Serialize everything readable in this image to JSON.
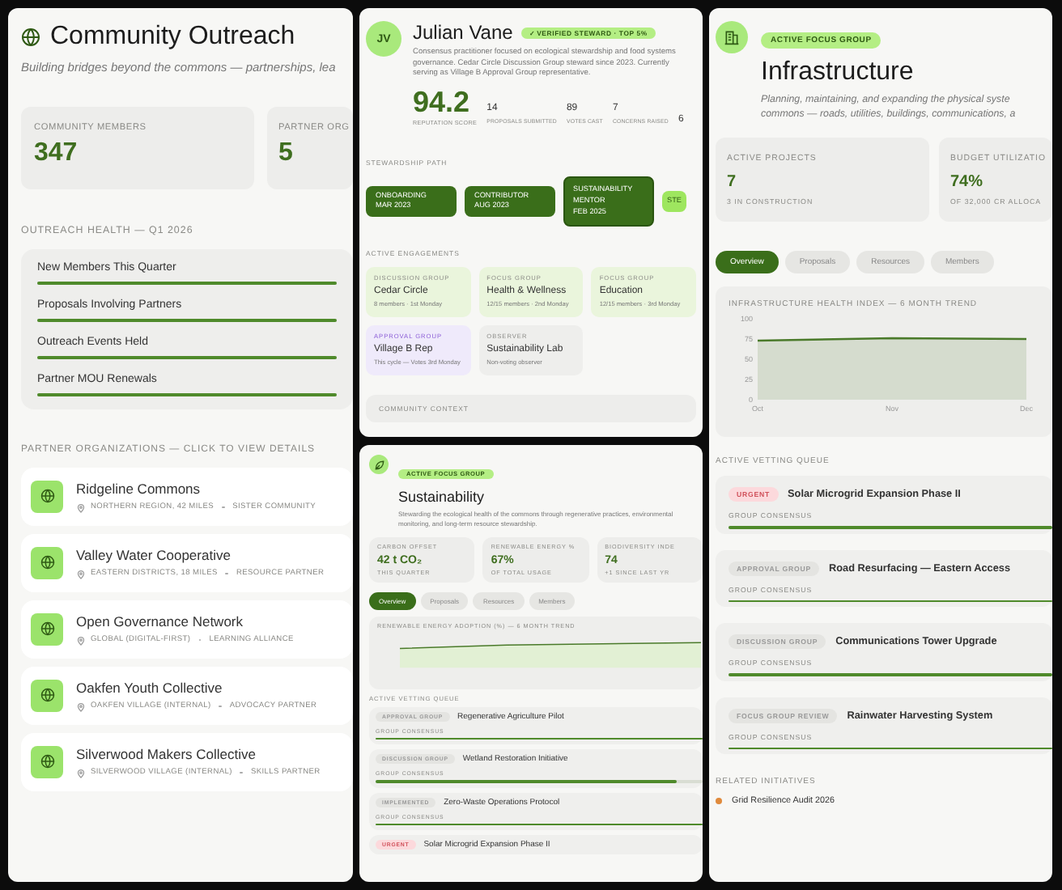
{
  "outreach": {
    "title": "Community Outreach",
    "subtitle": "Building bridges beyond the commons — partnerships, lea",
    "stats": [
      {
        "label": "COMMUNITY MEMBERS",
        "value": "347"
      },
      {
        "label": "PARTNER ORG",
        "value": "5"
      }
    ],
    "health_title": "OUTREACH HEALTH — Q1 2026",
    "health": [
      {
        "label": "New Members This Quarter",
        "level": 1
      },
      {
        "label": "Proposals Involving Partners",
        "level": 1
      },
      {
        "label": "Outreach Events Held",
        "level": 1
      },
      {
        "label": "Partner MOU Renewals",
        "level": 1
      }
    ],
    "partners_title": "PARTNER ORGANIZATIONS — CLICK TO VIEW DETAILS",
    "partners": [
      {
        "name": "Ridgeline Commons",
        "location": "NORTHERN REGION, 42 MILES",
        "type": "SISTER COMMUNITY"
      },
      {
        "name": "Valley Water Cooperative",
        "location": "EASTERN DISTRICTS, 18 MILES",
        "type": "RESOURCE PARTNER"
      },
      {
        "name": "Open Governance Network",
        "location": "GLOBAL (DIGITAL-FIRST)",
        "type": "LEARNING ALLIANCE"
      },
      {
        "name": "Oakfen Youth Collective",
        "location": "OAKFEN VILLAGE (INTERNAL)",
        "type": "ADVOCACY PARTNER"
      },
      {
        "name": "Silverwood Makers Collective",
        "location": "SILVERWOOD VILLAGE (INTERNAL)",
        "type": "SKILLS PARTNER"
      }
    ]
  },
  "profile": {
    "initials": "JV",
    "name": "Julian Vane",
    "badge": "✓ VERIFIED STEWARD · TOP 5%",
    "bio": "Consensus practitioner focused on ecological stewardship and food systems governance. Cedar Circle Discussion Group steward since 2023. Currently serving as Village B Approval Group representative.",
    "score": "94.2",
    "score_label": "REPUTATION SCORE",
    "stats": [
      {
        "value": "14",
        "label": "PROPOSALS SUBMITTED"
      },
      {
        "value": "89",
        "label": "VOTES CAST"
      },
      {
        "value": "7",
        "label": "CONCERNS RAISED"
      },
      {
        "value": "6"
      }
    ],
    "path_title": "STEWARDSHIP PATH",
    "path": [
      {
        "label": "ONBOARDING",
        "date": "MAR 2023",
        "kind": "done"
      },
      {
        "label": "CONTRIBUTOR",
        "date": "AUG 2023",
        "kind": "done"
      },
      {
        "label": "SUSTAINABILITY MENTOR",
        "date": "FEB 2025",
        "kind": "current"
      },
      {
        "label": "STE",
        "kind": "next"
      }
    ],
    "engagements_title": "ACTIVE ENGAGEMENTS",
    "engagements": [
      {
        "type": "DISCUSSION GROUP",
        "name": "Cedar Circle",
        "meta": "8 members · 1st Monday",
        "kind": "group"
      },
      {
        "type": "FOCUS GROUP",
        "name": "Health & Wellness",
        "meta": "12/15 members · 2nd Monday",
        "kind": "group"
      },
      {
        "type": "FOCUS GROUP",
        "name": "Education",
        "meta": "12/15 members · 3rd Monday",
        "kind": "group"
      },
      {
        "type": "APPROVAL GROUP",
        "name": "Village B Rep",
        "meta": "This cycle — Votes 3rd Monday",
        "kind": "approval"
      },
      {
        "type": "OBSERVER",
        "name": "Sustainability Lab",
        "meta": "Non-voting observer",
        "kind": "observer"
      }
    ],
    "context_title": "COMMUNITY CONTEXT"
  },
  "sustainability": {
    "badge": "ACTIVE FOCUS GROUP",
    "title": "Sustainability",
    "description": "Stewarding the ecological health of the commons through regenerative practices, environmental monitoring, and long-term resource stewardship.",
    "stats": [
      {
        "label": "CARBON OFFSET",
        "value": "42 t CO₂",
        "note": "THIS QUARTER"
      },
      {
        "label": "RENEWABLE ENERGY %",
        "value": "67%",
        "note": "OF TOTAL USAGE"
      },
      {
        "label": "BIODIVERSITY INDE",
        "value": "74",
        "note": "+1 SINCE LAST YR"
      }
    ],
    "tabs": [
      {
        "label": "Overview",
        "selected": true
      },
      {
        "label": "Proposals",
        "selected": false
      },
      {
        "label": "Resources",
        "selected": false
      },
      {
        "label": "Members",
        "selected": false
      }
    ],
    "chart_title": "RENEWABLE ENERGY ADOPTION (%) — 6 MONTH TREND",
    "queue_title": "ACTIVE VETTING QUEUE",
    "queue": [
      {
        "tag": "APPROVAL GROUP",
        "kind": "stage",
        "title": "Regenerative Agriculture Pilot",
        "consensus": "GROUP CONSENSUS",
        "level": 1
      },
      {
        "tag": "DISCUSSION GROUP",
        "kind": "stage",
        "title": "Wetland Restoration Initiative",
        "consensus": "GROUP CONSENSUS",
        "level": 0.92
      },
      {
        "tag": "IMPLEMENTED",
        "kind": "stage",
        "title": "Zero-Waste Operations Protocol",
        "consensus": "GROUP CONSENSUS",
        "level": 1
      },
      {
        "tag": "URGENT",
        "kind": "urgent",
        "title": "Solar Microgrid Expansion Phase II"
      }
    ]
  },
  "infrastructure": {
    "badge": "ACTIVE FOCUS GROUP",
    "title": "Infrastructure",
    "description_lines": [
      "Planning, maintaining, and expanding the physical syste",
      "commons — roads, utilities, buildings, communications, a"
    ],
    "stats": [
      {
        "label": "ACTIVE PROJECTS",
        "value": "7",
        "note": "3 IN CONSTRUCTION"
      },
      {
        "label": "BUDGET UTILIZATIO",
        "value": "74%",
        "note": "OF 32,000 CR ALLOCA"
      }
    ],
    "tabs": [
      {
        "label": "Overview",
        "selected": true
      },
      {
        "label": "Proposals",
        "selected": false
      },
      {
        "label": "Resources",
        "selected": false
      },
      {
        "label": "Members",
        "selected": false
      }
    ],
    "chart_data": {
      "type": "area",
      "title": "INFRASTRUCTURE HEALTH INDEX — 6 MONTH TREND",
      "x": [
        "Oct",
        "Nov",
        "Dec"
      ],
      "yticks": [
        0,
        25,
        50,
        75,
        100
      ],
      "ylim": [
        0,
        100
      ],
      "series": [
        {
          "color": "#4a7a2a",
          "values": [
            73,
            76,
            75
          ]
        }
      ]
    },
    "queue_title": "ACTIVE VETTING QUEUE",
    "queue": [
      {
        "tag": "URGENT",
        "kind": "urgent",
        "title": "Solar Microgrid Expansion Phase II",
        "consensus": "GROUP CONSENSUS",
        "level": 1
      },
      {
        "tag": "APPROVAL GROUP",
        "kind": "stage",
        "title": "Road Resurfacing — Eastern Access",
        "consensus": "GROUP CONSENSUS",
        "level": 1
      },
      {
        "tag": "DISCUSSION GROUP",
        "kind": "stage",
        "title": "Communications Tower Upgrade",
        "consensus": "GROUP CONSENSUS",
        "level": 1
      },
      {
        "tag": "FOCUS GROUP REVIEW",
        "kind": "stage",
        "title": "Rainwater Harvesting System",
        "consensus": "GROUP CONSENSUS",
        "level": 1
      }
    ],
    "related_title": "RELATED INITIATIVES",
    "related": [
      "Grid Resilience Audit 2026"
    ]
  }
}
